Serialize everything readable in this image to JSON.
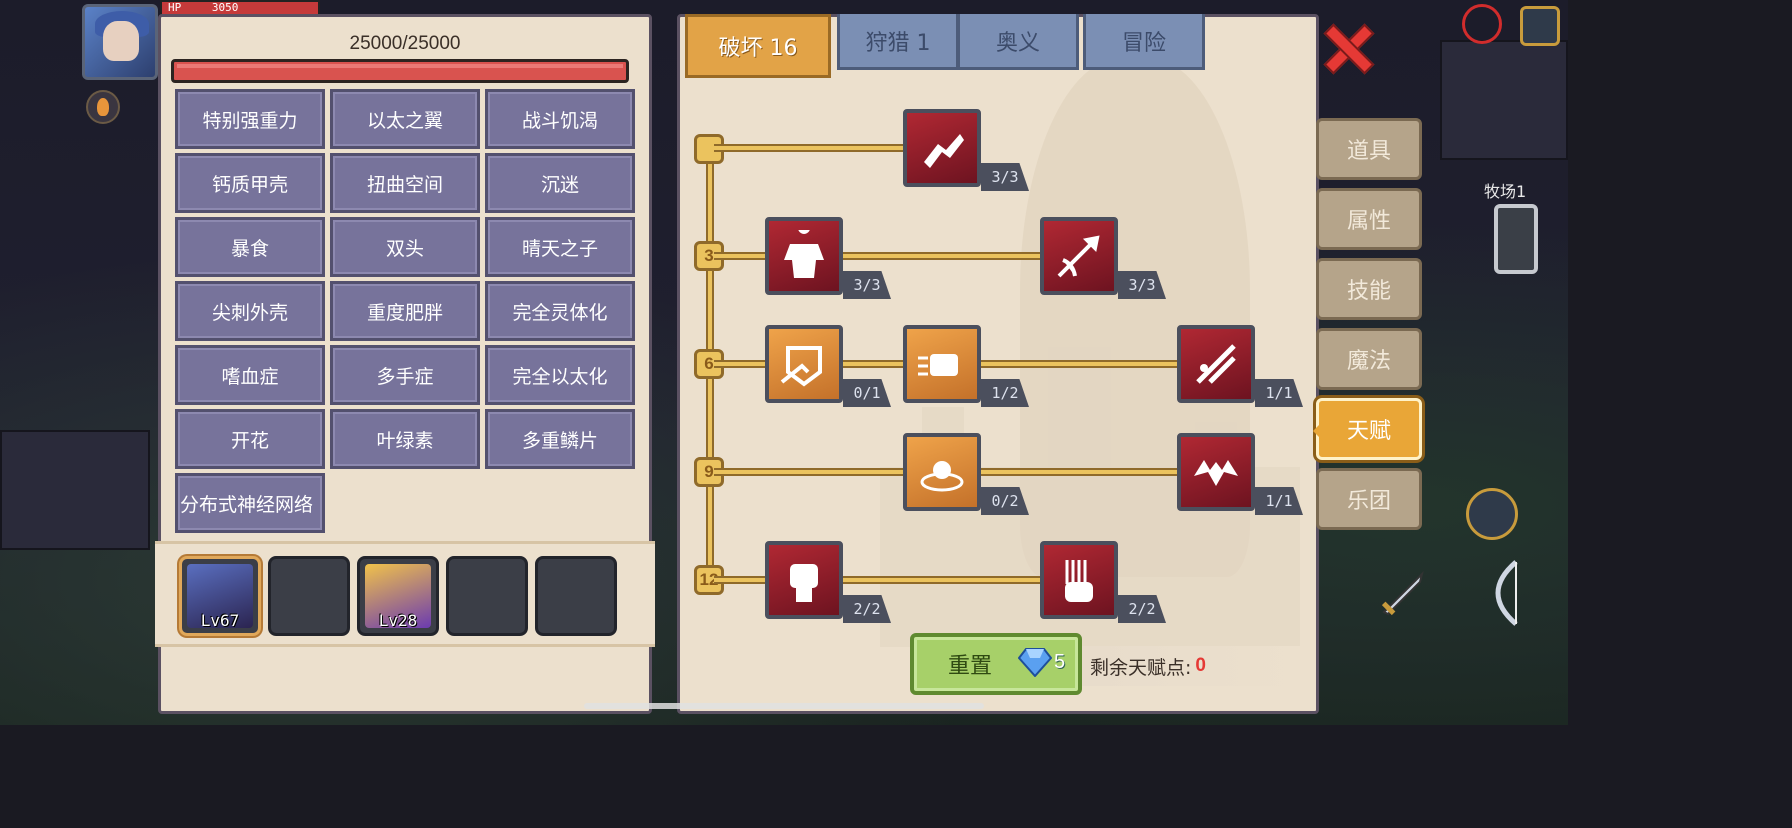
{
  "player": {
    "hp_bar_label": "HP",
    "hp_bar_value": "3050"
  },
  "left_panel": {
    "hp_text": "25000/25000",
    "hp_fill_fraction": 1.0,
    "traits": [
      "特别强重力",
      "以太之翼",
      "战斗饥渴",
      "钙质甲壳",
      "扭曲空间",
      "沉迷",
      "暴食",
      "双头",
      "晴天之子",
      "尖刺外壳",
      "重度肥胖",
      "完全灵体化",
      "嗜血症",
      "多手症",
      "完全以太化",
      "开花",
      "叶绿素",
      "多重鳞片",
      "分布式神经网络"
    ],
    "pets": [
      {
        "level": "Lv67",
        "filled": true
      },
      {
        "level": "",
        "filled": false
      },
      {
        "level": "Lv28",
        "filled": true
      },
      {
        "level": "",
        "filled": false
      },
      {
        "level": "",
        "filled": false
      }
    ]
  },
  "tabs": [
    {
      "label": "破坏 16",
      "active": true
    },
    {
      "label": "狩猎 1",
      "active": false
    },
    {
      "label": "奥义",
      "active": false
    },
    {
      "label": "冒险",
      "active": false
    }
  ],
  "talent_tree": {
    "levels": [
      "3",
      "6",
      "9",
      "12"
    ],
    "talents": [
      {
        "icon": "arm-wrestle-icon",
        "count": "3/3",
        "color": "red"
      },
      {
        "icon": "muscle-body-icon",
        "count": "3/3",
        "color": "red"
      },
      {
        "icon": "piercing-arrow-icon",
        "count": "3/3",
        "color": "red"
      },
      {
        "icon": "shield-break-icon",
        "count": "0/1",
        "color": "orange"
      },
      {
        "icon": "punch-fist-icon",
        "count": "1/2",
        "color": "orange"
      },
      {
        "icon": "slash-strike-icon",
        "count": "1/1",
        "color": "red"
      },
      {
        "icon": "orb-ripple-icon",
        "count": "0/2",
        "color": "orange"
      },
      {
        "icon": "demon-wing-icon",
        "count": "1/1",
        "color": "red"
      },
      {
        "icon": "raised-fist-icon",
        "count": "2/2",
        "color": "red"
      },
      {
        "icon": "power-palm-icon",
        "count": "2/2",
        "color": "red"
      }
    ]
  },
  "reset": {
    "label": "重置",
    "gem_cost": "5"
  },
  "points": {
    "label": "剩余天赋点:",
    "value": "0"
  },
  "side_menu": [
    {
      "label": "道具",
      "active": false
    },
    {
      "label": "属性",
      "active": false
    },
    {
      "label": "技能",
      "active": false
    },
    {
      "label": "魔法",
      "active": false
    },
    {
      "label": "天赋",
      "active": true
    },
    {
      "label": "乐团",
      "active": false
    }
  ],
  "map": {
    "label": "牧场1"
  },
  "colors": {
    "panel_bg": "#ece0cd",
    "trait_bg": "#77739b",
    "active_tab": "#e2a347",
    "talent_red": "#b02833",
    "talent_orange": "#efa34a",
    "reset_green": "#a7d069",
    "points_zero": "#e53935"
  }
}
